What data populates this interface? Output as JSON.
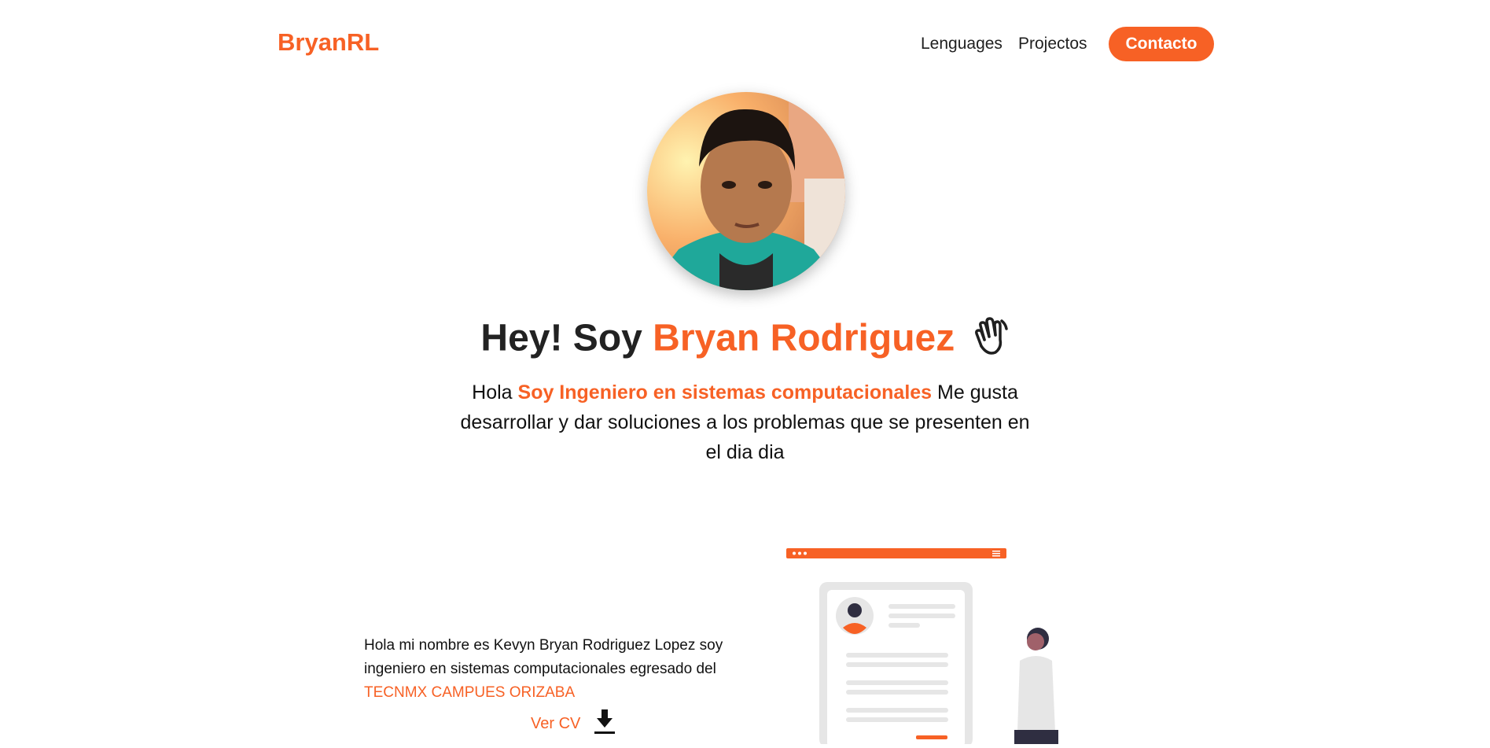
{
  "nav": {
    "brand": "BryanRL",
    "links": [
      "Lenguages",
      "Projectos"
    ],
    "contact": "Contacto"
  },
  "hero": {
    "title_prefix": "Hey! Soy ",
    "title_name": "Bryan Rodriguez",
    "intro_start": "Hola ",
    "intro_highlight": "Soy Ingeniero en sistemas computacionales",
    "intro_rest": " Me gusta desarrollar y dar soluciones a los problemas que se presenten en el dia dia"
  },
  "about": {
    "text": "Hola mi nombre es Kevyn Bryan Rodriguez Lopez soy ingeniero en sistemas computacionales egresado del ",
    "school": "TECNMX CAMPUES ORIZABA",
    "cv_label": "Ver CV"
  },
  "colors": {
    "accent": "#f76125",
    "text": "#1f1f1f"
  },
  "icons": [
    "waving-hand-icon",
    "download-icon"
  ]
}
